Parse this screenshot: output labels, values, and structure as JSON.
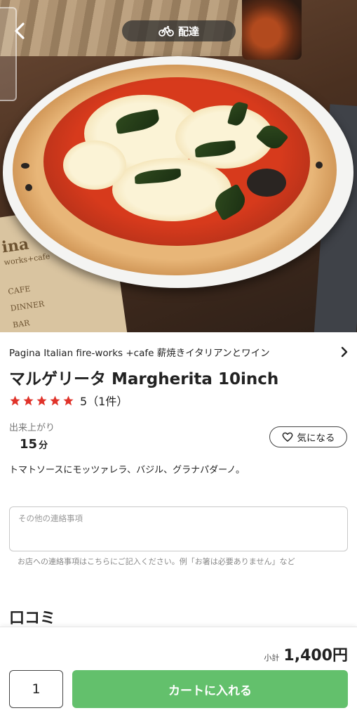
{
  "header": {
    "delivery_label": "配達"
  },
  "hero": {
    "menu_card_lines": [
      "ina",
      "works+cafe",
      "CAFE",
      "DINNER",
      "BAR"
    ]
  },
  "store": {
    "name": "Pagina Italian fire-works +cafe 薪焼きイタリアンとワイン"
  },
  "item": {
    "title": "マルゲリータ Margherita 10inch",
    "rating_stars": 5,
    "rating_text": "5（1件）",
    "ready_label": "出来上がり",
    "ready_value": "15",
    "ready_unit": "分",
    "favorite_label": "気になる",
    "description": "トマトソースにモッツァレラ、バジル、グラナパダーノ。"
  },
  "note": {
    "placeholder": "その他の連絡事項",
    "hint": "お店への連絡事項はこちらにご記入ください。例「お箸は必要ありません」など"
  },
  "reviews": {
    "title": "口コミ"
  },
  "cart": {
    "subtotal_label": "小計",
    "subtotal_value": "1,400円",
    "quantity": "1",
    "add_label": "カートに入れる"
  },
  "colors": {
    "accent_green": "#63c06c",
    "star_red": "#e0332a"
  }
}
